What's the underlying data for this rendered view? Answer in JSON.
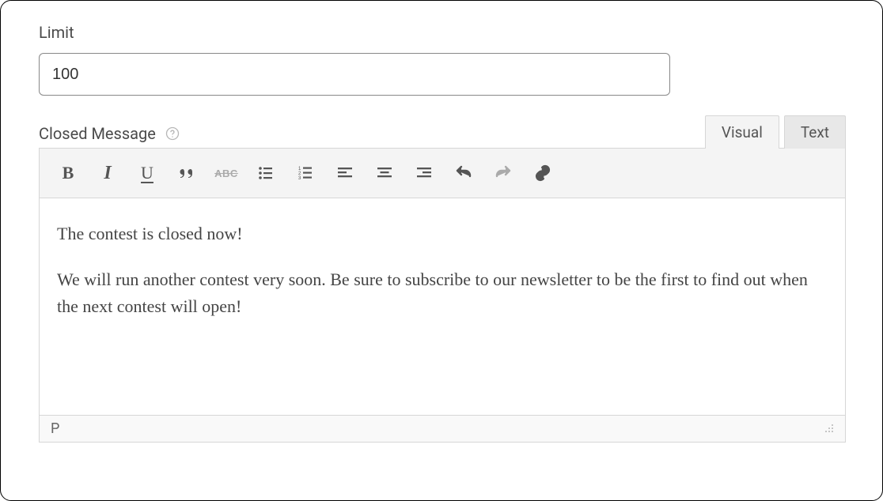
{
  "limit": {
    "label": "Limit",
    "value": "100"
  },
  "closedMessage": {
    "label": "Closed Message",
    "tabs": {
      "visual": "Visual",
      "text": "Text",
      "active": "visual"
    },
    "content": {
      "p1": "The contest is closed now!",
      "p2": "We will run another contest very soon. Be sure to subscribe to our newsletter to be the first to find out when the next contest will open!"
    },
    "statusPath": "P"
  },
  "toolbar": {
    "bold": "B",
    "italic": "I",
    "underline": "U",
    "strike": "ABC"
  }
}
